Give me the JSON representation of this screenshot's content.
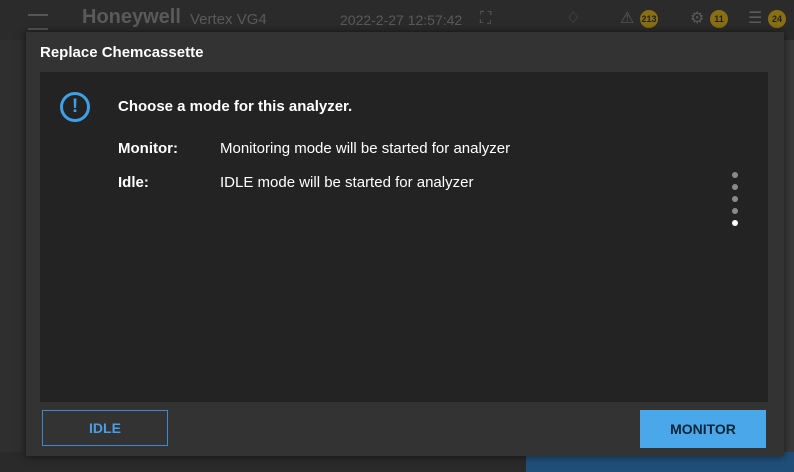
{
  "background": {
    "brand": "Honeywell",
    "model": "Vertex VG4",
    "datetime": "2022-2-27 12:57:42",
    "badges": [
      "213",
      "11",
      "24"
    ]
  },
  "dialog": {
    "title": "Replace Chemcassette",
    "prompt": "Choose a mode for this analyzer.",
    "rows": [
      {
        "label": "Monitor:",
        "description": "Monitoring mode will be started for analyzer"
      },
      {
        "label": "Idle:",
        "description": "IDLE mode will be started for analyzer"
      }
    ],
    "buttons": {
      "idle": "IDLE",
      "monitor": "MONITOR"
    }
  },
  "colors": {
    "accent": "#4aa8ea",
    "dialog_bg": "#333333",
    "body_bg": "#232323"
  },
  "icons": {
    "info": "info-circle-icon",
    "pager": "page-dots-icon"
  }
}
